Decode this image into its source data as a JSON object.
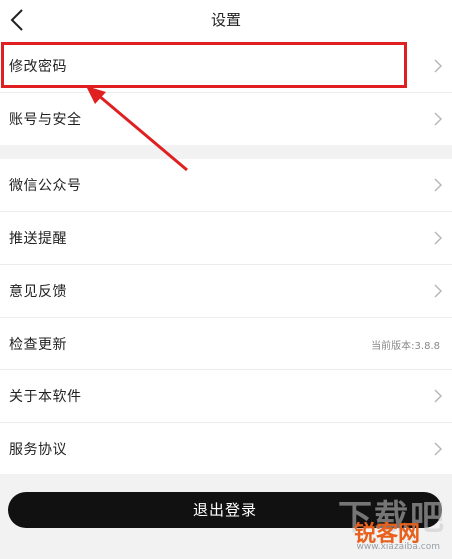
{
  "header": {
    "title": "设置"
  },
  "section1": {
    "items": [
      {
        "label": "修改密码"
      },
      {
        "label": "账号与安全"
      }
    ]
  },
  "section2": {
    "items": [
      {
        "label": "微信公众号"
      },
      {
        "label": "推送提醒"
      },
      {
        "label": "意见反馈"
      },
      {
        "label": "检查更新",
        "value": "当前版本:3.8.8"
      },
      {
        "label": "关于本软件"
      },
      {
        "label": "服务协议"
      }
    ]
  },
  "logout": {
    "label": "退出登录"
  },
  "watermark": {
    "big_text": "下载吧",
    "site_text": "锐客网",
    "url_text": "www.xiazaiba.com"
  },
  "colors": {
    "annotation": "#e02020",
    "button_bg": "#111111",
    "section_gap": "#f2f2f2"
  },
  "icons": {
    "back": "back-arrow-icon",
    "chevron": "chevron-right-icon"
  }
}
